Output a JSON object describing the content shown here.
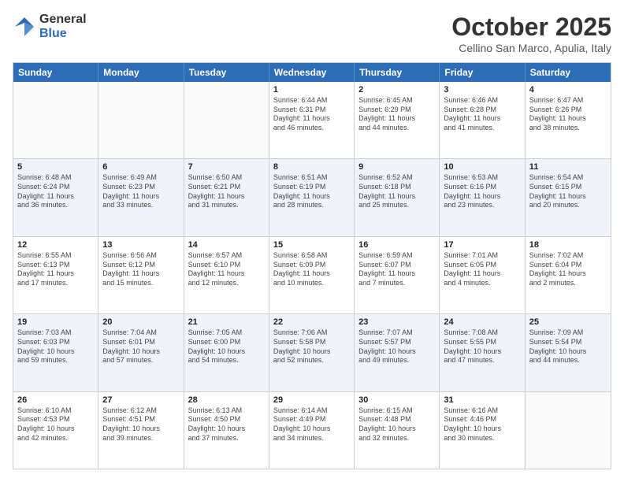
{
  "header": {
    "logo_general": "General",
    "logo_blue": "Blue",
    "month_title": "October 2025",
    "subtitle": "Cellino San Marco, Apulia, Italy"
  },
  "day_headers": [
    "Sunday",
    "Monday",
    "Tuesday",
    "Wednesday",
    "Thursday",
    "Friday",
    "Saturday"
  ],
  "weeks": [
    {
      "alt": false,
      "days": [
        {
          "date": "",
          "info": ""
        },
        {
          "date": "",
          "info": ""
        },
        {
          "date": "",
          "info": ""
        },
        {
          "date": "1",
          "info": "Sunrise: 6:44 AM\nSunset: 6:31 PM\nDaylight: 11 hours\nand 46 minutes."
        },
        {
          "date": "2",
          "info": "Sunrise: 6:45 AM\nSunset: 6:29 PM\nDaylight: 11 hours\nand 44 minutes."
        },
        {
          "date": "3",
          "info": "Sunrise: 6:46 AM\nSunset: 6:28 PM\nDaylight: 11 hours\nand 41 minutes."
        },
        {
          "date": "4",
          "info": "Sunrise: 6:47 AM\nSunset: 6:26 PM\nDaylight: 11 hours\nand 38 minutes."
        }
      ]
    },
    {
      "alt": true,
      "days": [
        {
          "date": "5",
          "info": "Sunrise: 6:48 AM\nSunset: 6:24 PM\nDaylight: 11 hours\nand 36 minutes."
        },
        {
          "date": "6",
          "info": "Sunrise: 6:49 AM\nSunset: 6:23 PM\nDaylight: 11 hours\nand 33 minutes."
        },
        {
          "date": "7",
          "info": "Sunrise: 6:50 AM\nSunset: 6:21 PM\nDaylight: 11 hours\nand 31 minutes."
        },
        {
          "date": "8",
          "info": "Sunrise: 6:51 AM\nSunset: 6:19 PM\nDaylight: 11 hours\nand 28 minutes."
        },
        {
          "date": "9",
          "info": "Sunrise: 6:52 AM\nSunset: 6:18 PM\nDaylight: 11 hours\nand 25 minutes."
        },
        {
          "date": "10",
          "info": "Sunrise: 6:53 AM\nSunset: 6:16 PM\nDaylight: 11 hours\nand 23 minutes."
        },
        {
          "date": "11",
          "info": "Sunrise: 6:54 AM\nSunset: 6:15 PM\nDaylight: 11 hours\nand 20 minutes."
        }
      ]
    },
    {
      "alt": false,
      "days": [
        {
          "date": "12",
          "info": "Sunrise: 6:55 AM\nSunset: 6:13 PM\nDaylight: 11 hours\nand 17 minutes."
        },
        {
          "date": "13",
          "info": "Sunrise: 6:56 AM\nSunset: 6:12 PM\nDaylight: 11 hours\nand 15 minutes."
        },
        {
          "date": "14",
          "info": "Sunrise: 6:57 AM\nSunset: 6:10 PM\nDaylight: 11 hours\nand 12 minutes."
        },
        {
          "date": "15",
          "info": "Sunrise: 6:58 AM\nSunset: 6:09 PM\nDaylight: 11 hours\nand 10 minutes."
        },
        {
          "date": "16",
          "info": "Sunrise: 6:59 AM\nSunset: 6:07 PM\nDaylight: 11 hours\nand 7 minutes."
        },
        {
          "date": "17",
          "info": "Sunrise: 7:01 AM\nSunset: 6:05 PM\nDaylight: 11 hours\nand 4 minutes."
        },
        {
          "date": "18",
          "info": "Sunrise: 7:02 AM\nSunset: 6:04 PM\nDaylight: 11 hours\nand 2 minutes."
        }
      ]
    },
    {
      "alt": true,
      "days": [
        {
          "date": "19",
          "info": "Sunrise: 7:03 AM\nSunset: 6:03 PM\nDaylight: 10 hours\nand 59 minutes."
        },
        {
          "date": "20",
          "info": "Sunrise: 7:04 AM\nSunset: 6:01 PM\nDaylight: 10 hours\nand 57 minutes."
        },
        {
          "date": "21",
          "info": "Sunrise: 7:05 AM\nSunset: 6:00 PM\nDaylight: 10 hours\nand 54 minutes."
        },
        {
          "date": "22",
          "info": "Sunrise: 7:06 AM\nSunset: 5:58 PM\nDaylight: 10 hours\nand 52 minutes."
        },
        {
          "date": "23",
          "info": "Sunrise: 7:07 AM\nSunset: 5:57 PM\nDaylight: 10 hours\nand 49 minutes."
        },
        {
          "date": "24",
          "info": "Sunrise: 7:08 AM\nSunset: 5:55 PM\nDaylight: 10 hours\nand 47 minutes."
        },
        {
          "date": "25",
          "info": "Sunrise: 7:09 AM\nSunset: 5:54 PM\nDaylight: 10 hours\nand 44 minutes."
        }
      ]
    },
    {
      "alt": false,
      "days": [
        {
          "date": "26",
          "info": "Sunrise: 6:10 AM\nSunset: 4:53 PM\nDaylight: 10 hours\nand 42 minutes."
        },
        {
          "date": "27",
          "info": "Sunrise: 6:12 AM\nSunset: 4:51 PM\nDaylight: 10 hours\nand 39 minutes."
        },
        {
          "date": "28",
          "info": "Sunrise: 6:13 AM\nSunset: 4:50 PM\nDaylight: 10 hours\nand 37 minutes."
        },
        {
          "date": "29",
          "info": "Sunrise: 6:14 AM\nSunset: 4:49 PM\nDaylight: 10 hours\nand 34 minutes."
        },
        {
          "date": "30",
          "info": "Sunrise: 6:15 AM\nSunset: 4:48 PM\nDaylight: 10 hours\nand 32 minutes."
        },
        {
          "date": "31",
          "info": "Sunrise: 6:16 AM\nSunset: 4:46 PM\nDaylight: 10 hours\nand 30 minutes."
        },
        {
          "date": "",
          "info": ""
        }
      ]
    }
  ]
}
